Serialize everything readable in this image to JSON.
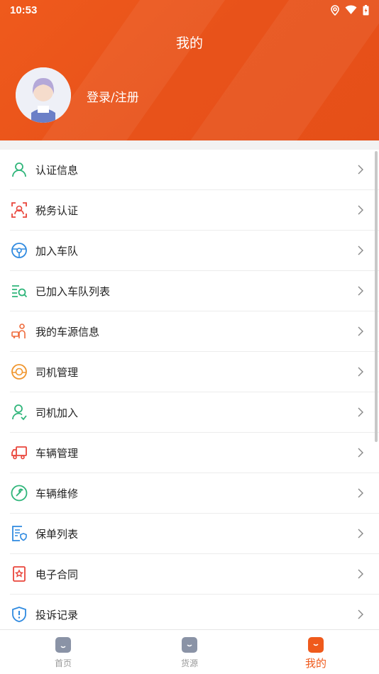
{
  "status_bar": {
    "time": "10:53"
  },
  "header": {
    "title": "我的",
    "login_label": "登录/注册"
  },
  "menu": {
    "items": [
      {
        "label": "认证信息",
        "icon": "person-icon",
        "color": "#2fb57a"
      },
      {
        "label": "税务认证",
        "icon": "face-scan-icon",
        "color": "#e9453b"
      },
      {
        "label": "加入车队",
        "icon": "steering-wheel-icon",
        "color": "#2f8ae0"
      },
      {
        "label": "已加入车队列表",
        "icon": "list-search-icon",
        "color": "#2fb57a"
      },
      {
        "label": "我的车源信息",
        "icon": "vehicle-person-icon",
        "color": "#ef6a3a"
      },
      {
        "label": "司机管理",
        "icon": "driver-wheel-icon",
        "color": "#f0962e"
      },
      {
        "label": "司机加入",
        "icon": "person-add-icon",
        "color": "#2fb57a"
      },
      {
        "label": "车辆管理",
        "icon": "truck-icon",
        "color": "#e9453b"
      },
      {
        "label": "车辆维修",
        "icon": "wrench-icon",
        "color": "#2fb57a"
      },
      {
        "label": "保单列表",
        "icon": "policy-shield-icon",
        "color": "#2f8ae0"
      },
      {
        "label": "电子合同",
        "icon": "contract-seal-icon",
        "color": "#e9453b"
      },
      {
        "label": "投诉记录",
        "icon": "complaint-shield-icon",
        "color": "#2f8ae0"
      }
    ]
  },
  "tabbar": {
    "tabs": [
      {
        "label": "首页",
        "icon": "home-icon"
      },
      {
        "label": "货源",
        "icon": "cargo-icon"
      },
      {
        "label": "我的",
        "icon": "mine-icon"
      }
    ],
    "active_color": "#ef5a1c"
  }
}
